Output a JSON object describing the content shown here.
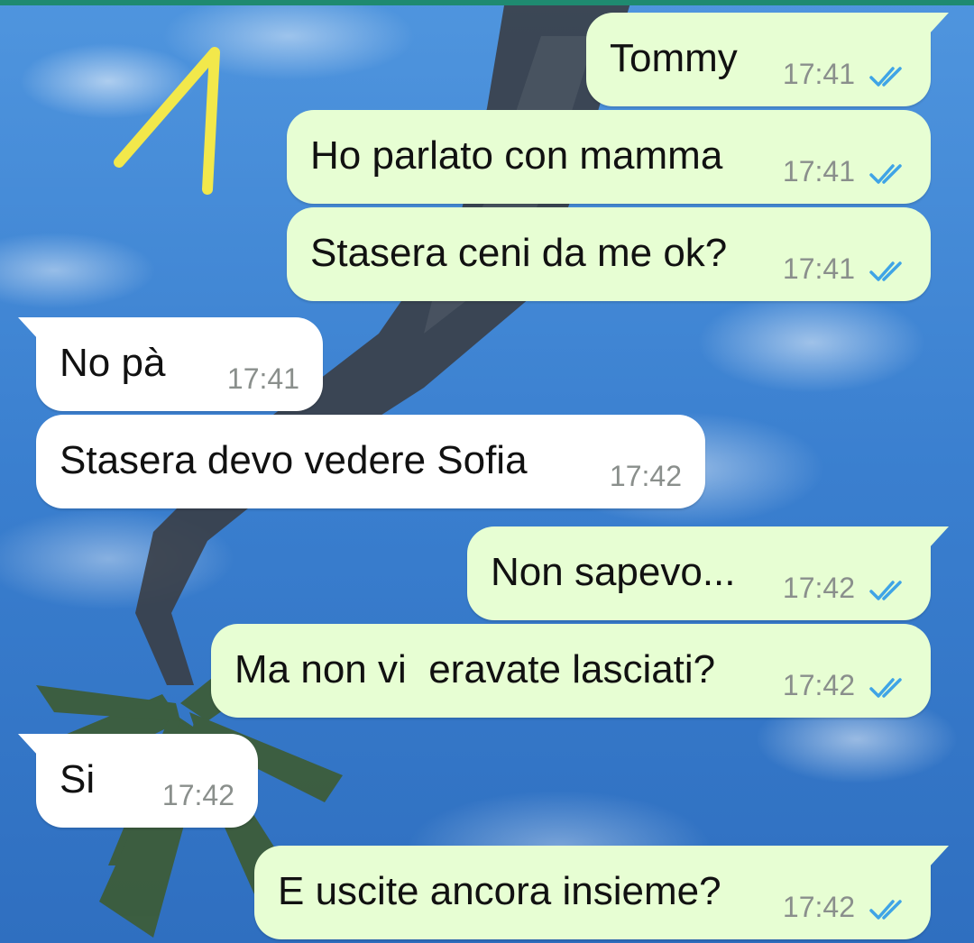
{
  "chat": {
    "messages": [
      {
        "text": "Tommy",
        "time": "17:41",
        "status": "read",
        "direction": "out"
      },
      {
        "text": "Ho parlato con mamma",
        "time": "17:41",
        "status": "read",
        "direction": "out"
      },
      {
        "text": "Stasera ceni da me ok?",
        "time": "17:41",
        "status": "read",
        "direction": "out"
      },
      {
        "text": "No pà",
        "time": "17:41",
        "direction": "in"
      },
      {
        "text": "Stasera devo vedere Sofia",
        "time": "17:42",
        "direction": "in"
      },
      {
        "text": "Non sapevo...",
        "time": "17:42",
        "status": "read",
        "direction": "out"
      },
      {
        "text": "Ma non vi  eravate lasciati?",
        "time": "17:42",
        "status": "read",
        "direction": "out"
      },
      {
        "text": "Si",
        "time": "17:42",
        "direction": "in"
      },
      {
        "text": "E uscite ancora insieme?",
        "time": "17:42",
        "status": "read",
        "direction": "out"
      }
    ]
  },
  "colors": {
    "outgoing_bubble": "#e7fed3",
    "incoming_bubble": "#ffffff",
    "read_check": "#3fa4e6",
    "timestamp": "#8a8f8c",
    "annotation": "#f2e84b"
  },
  "icons": {
    "read_receipt": "double-check-icon",
    "annotation": "handwritten-number-one"
  }
}
